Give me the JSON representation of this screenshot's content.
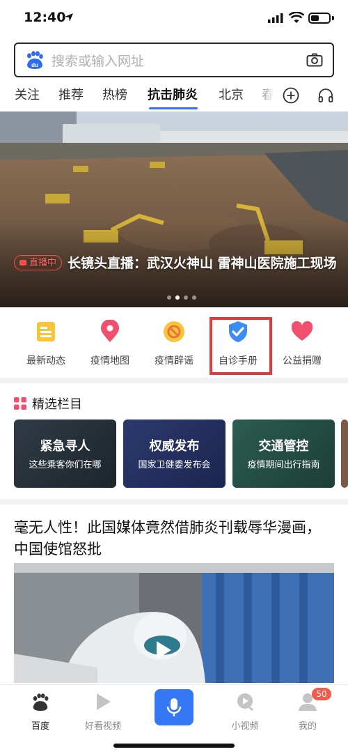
{
  "status_bar": {
    "time": "12:40",
    "battery_level": 0.45
  },
  "search": {
    "placeholder": "搜索或输入网址",
    "logo_text": "du"
  },
  "tabs": [
    {
      "label": "关注"
    },
    {
      "label": "推荐"
    },
    {
      "label": "热榜"
    },
    {
      "label": "抗击肺炎",
      "active": true
    },
    {
      "label": "北京"
    },
    {
      "label": "春"
    }
  ],
  "hero": {
    "live_label": "直播中",
    "caption": "长镜头直播：武汉火神山 雷神山医院施工现场",
    "page_index": 1,
    "page_count": 4
  },
  "quick_entries": [
    {
      "label": "最新动态",
      "icon": "news-icon",
      "color": "#f6c53a"
    },
    {
      "label": "疫情地图",
      "icon": "map-pin-icon",
      "color": "#f0506e"
    },
    {
      "label": "疫情辟谣",
      "icon": "no-rumor-icon",
      "color": "#f6b830"
    },
    {
      "label": "自诊手册",
      "icon": "shield-check-icon",
      "color": "#3b8cf5",
      "highlighted": true
    },
    {
      "label": "公益捐赠",
      "icon": "heart-icon",
      "color": "#f0506e"
    }
  ],
  "featured": {
    "title": "精选栏目",
    "cards": [
      {
        "title": "紧急寻人",
        "subtitle": "这些乘客你们在哪"
      },
      {
        "title": "权威发布",
        "subtitle": "国家卫健委发布会"
      },
      {
        "title": "交通管控",
        "subtitle": "疫情期间出行指南"
      }
    ]
  },
  "article": {
    "title": "毫无人性！此国媒体竟然借肺炎刊载辱华漫画，中国使馆怒批"
  },
  "bottom_nav": [
    {
      "label": "百度",
      "icon": "baidu-paw-icon",
      "active": true
    },
    {
      "label": "好看视频",
      "icon": "play-triangle-icon"
    },
    {
      "label": "",
      "icon": "microphone-icon"
    },
    {
      "label": "小视频",
      "icon": "small-video-icon"
    },
    {
      "label": "我的",
      "icon": "user-icon",
      "badge": "50"
    }
  ],
  "colors": {
    "accent": "#3478f6",
    "live_red": "#ff4a4a",
    "highlight_red": "#e03a3a"
  }
}
